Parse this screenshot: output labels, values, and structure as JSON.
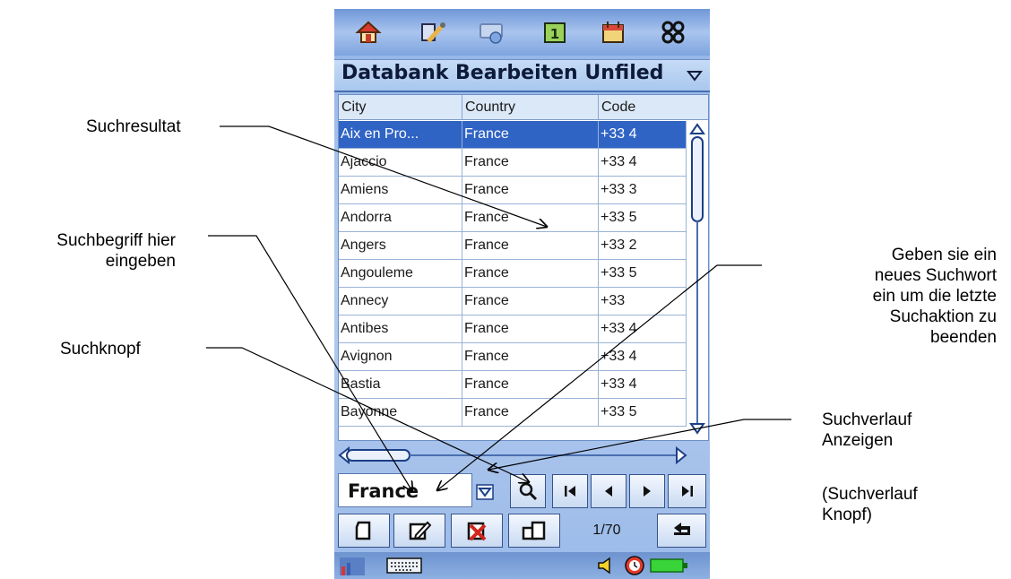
{
  "annotations": {
    "suchresultat": "Suchresultat",
    "suchbegriff_line1": "Suchbegriff hier",
    "suchbegriff_line2": "eingeben",
    "suchknopf": "Suchknopf",
    "neues_line1": "Geben sie ein",
    "neues_line2": "neues Suchwort",
    "neues_line3": "ein um die letzte",
    "neues_line4": "Suchaktion zu",
    "neues_line5": "beenden",
    "verlauf_line1": "Suchverlauf",
    "verlauf_line2": "Anzeigen",
    "knopf_line1": "(Suchverlauf",
    "knopf_line2": "Knopf)"
  },
  "app": {
    "title": "Databank Bearbeiten Unfiled",
    "top_icons": [
      "home-icon",
      "tools-icon",
      "connect-icon",
      "calendar-icon",
      "datebook-icon",
      "applications-icon"
    ]
  },
  "table": {
    "headers": [
      "City",
      "Country",
      "Code"
    ],
    "rows": [
      [
        "Aix en Pro...",
        "France",
        "+33 4"
      ],
      [
        "Ajaccio",
        "France",
        "+33 4"
      ],
      [
        "Amiens",
        "France",
        "+33 3"
      ],
      [
        "Andorra",
        "France",
        "+33 5"
      ],
      [
        "Angers",
        "France",
        "+33 2"
      ],
      [
        "Angouleme",
        "France",
        "+33 5"
      ],
      [
        "Annecy",
        "France",
        "+33"
      ],
      [
        "Antibes",
        "France",
        "+33 4"
      ],
      [
        "Avignon",
        "France",
        "+33 4"
      ],
      [
        "Bastia",
        "France",
        "+33 4"
      ],
      [
        "Bayonne",
        "France",
        "+33 5"
      ]
    ],
    "selected_row": 0
  },
  "find": {
    "search_value": "France"
  },
  "pager": {
    "page_indicator": "1/70"
  },
  "colors": {
    "selection": "#2f63c4",
    "header_bg": "#dbe8f8",
    "device_blue": "#9cbbe9"
  }
}
